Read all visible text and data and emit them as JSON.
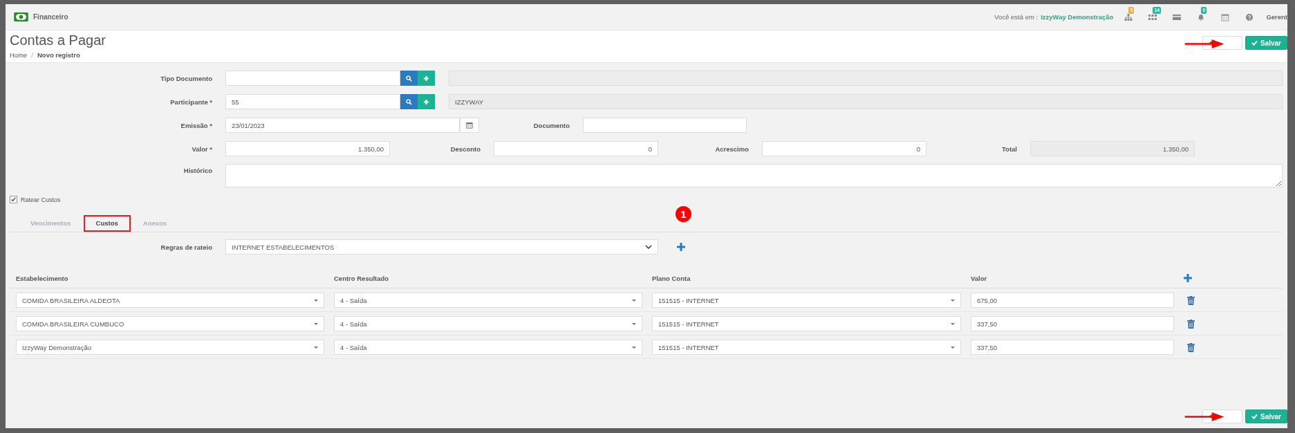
{
  "header": {
    "app_name": "Financeiro",
    "location_label": "Você está em :",
    "location": "IzzyWay Demonstração",
    "icons": [
      {
        "kind": "sitemap",
        "badge": "5",
        "color": "#f0ad4e"
      },
      {
        "kind": "grid",
        "badge": "14",
        "color": "#26b99a"
      },
      {
        "kind": "card"
      },
      {
        "kind": "bell",
        "badge": "0",
        "color": "#26b99a"
      },
      {
        "kind": "calendar"
      },
      {
        "kind": "help"
      }
    ],
    "user": "Gerent"
  },
  "page": {
    "title": "Contas a Pagar",
    "breadcrumb": [
      "Home",
      "Novo registro"
    ],
    "breadcrumb_separator": "/"
  },
  "top_buttons": [
    {
      "kind": "cancel"
    },
    {
      "kind": "save",
      "label": "Salvar"
    }
  ],
  "form": {
    "tipo_documento": {
      "label": "Tipo Documento"
    },
    "participante": {
      "label": "Participante *",
      "value": "55",
      "description": "IZZYWAY"
    },
    "emissao": {
      "label": "Emissão *",
      "value": "23/01/2023"
    },
    "documento": {
      "label": "Documento"
    },
    "valor": {
      "label": "Valor *",
      "value": "1.350,00"
    },
    "desconto": {
      "label": "Desconto",
      "value": "0"
    },
    "acrescimo": {
      "label": "Acrescimo",
      "value": "0"
    },
    "total": {
      "label": "Total",
      "value": "1.350,00"
    },
    "historico": {
      "label": "Histórico"
    }
  },
  "ratear_custos": {
    "label": "Ratear Custos",
    "checked": true
  },
  "tabs": [
    {
      "label": "Vencimentos",
      "selected": false
    },
    {
      "label": "Custos",
      "selected": true
    },
    {
      "label": "Anexos",
      "selected": false
    }
  ],
  "step_badge": "1",
  "regras": {
    "label": "Regras de rateio",
    "value": "INTERNET ESTABELECIMENTOS"
  },
  "table": {
    "columns": [
      "Estabelecimento",
      "Centro Resultado",
      "Plano Conta",
      "Valor"
    ],
    "rows": [
      {
        "estabelecimento": "COMIDA BRASILEIRA ALDEOTA",
        "centro": "4 - Saída",
        "plano": "151515 - INTERNET",
        "valor": "675,00"
      },
      {
        "estabelecimento": "COMIDA BRASILEIRA CUMBUCO",
        "centro": "4 - Saída",
        "plano": "151515 - INTERNET",
        "valor": "337,50"
      },
      {
        "estabelecimento": "IzzyWay Demonstração",
        "centro": "4 - Saída",
        "plano": "151515 - INTERNET",
        "valor": "337,50"
      }
    ]
  },
  "bottom_buttons": [
    {
      "kind": "cancel"
    },
    {
      "kind": "save",
      "label": "Salvar"
    }
  ]
}
